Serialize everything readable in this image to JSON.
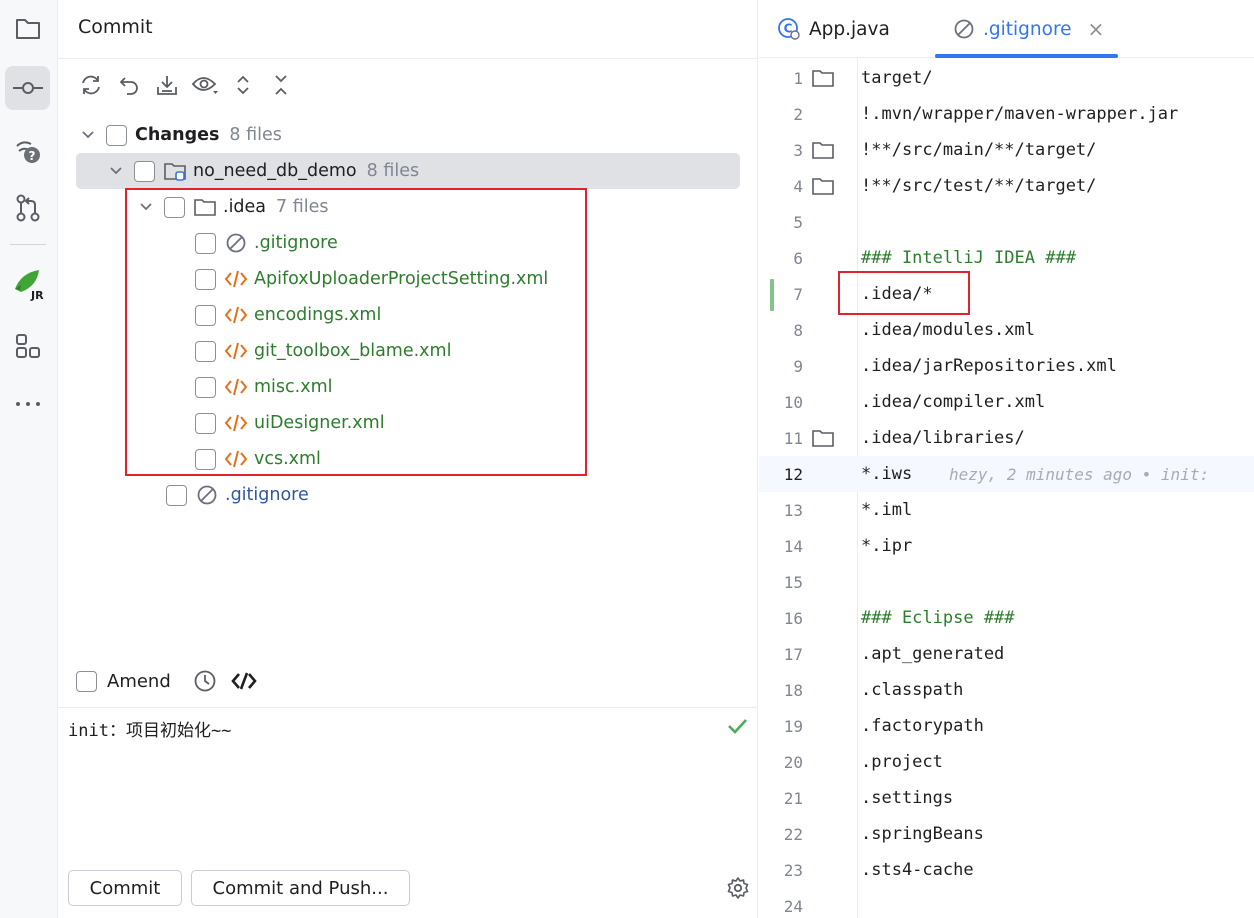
{
  "activity_bar": {
    "items": [
      {
        "name": "project-icon"
      },
      {
        "name": "commit-icon",
        "active": true
      },
      {
        "name": "vcs-hint-icon"
      },
      {
        "name": "pull-requests-icon"
      },
      {
        "name": "jrebel-icon",
        "label": "JR"
      },
      {
        "name": "structure-icon"
      },
      {
        "name": "more-icon"
      }
    ]
  },
  "commit_panel": {
    "title": "Commit",
    "toolbar": [
      "refresh-icon",
      "rollback-icon",
      "shelve-icon",
      "preview-icon",
      "expand-all-icon",
      "collapse-all-icon"
    ],
    "tree": {
      "changes": {
        "label": "Changes",
        "count": "8 files"
      },
      "module": {
        "label": "no_need_db_demo",
        "count": "8 files"
      },
      "idea": {
        "label": ".idea",
        "count": "7 files"
      },
      "idea_files": [
        {
          "label": ".gitignore",
          "icon": "ignore-icon"
        },
        {
          "label": "ApifoxUploaderProjectSetting.xml",
          "icon": "xml-icon"
        },
        {
          "label": "encodings.xml",
          "icon": "xml-icon"
        },
        {
          "label": "git_toolbox_blame.xml",
          "icon": "xml-icon"
        },
        {
          "label": "misc.xml",
          "icon": "xml-icon"
        },
        {
          "label": "uiDesigner.xml",
          "icon": "xml-icon"
        },
        {
          "label": "vcs.xml",
          "icon": "xml-icon"
        }
      ],
      "root_file": {
        "label": ".gitignore",
        "icon": "ignore-icon"
      }
    },
    "amend_label": "Amend",
    "message": "init：项目初始化~~",
    "commit_button": "Commit",
    "commit_push_button": "Commit and Push..."
  },
  "editor": {
    "tabs": [
      {
        "label": "App.java",
        "icon": "java-class-icon"
      },
      {
        "label": ".gitignore",
        "icon": "ignore-icon",
        "active": true,
        "close": "×"
      }
    ],
    "lines": [
      {
        "n": "1",
        "text": "target/",
        "folder": true
      },
      {
        "n": "2",
        "text": "!.mvn/wrapper/maven-wrapper.jar"
      },
      {
        "n": "3",
        "text": "!**/src/main/**/target/",
        "folder": true
      },
      {
        "n": "4",
        "text": "!**/src/test/**/target/",
        "folder": true
      },
      {
        "n": "5",
        "text": ""
      },
      {
        "n": "6",
        "text": "### IntelliJ IDEA ###",
        "comment": true
      },
      {
        "n": "7",
        "text": ".idea/*"
      },
      {
        "n": "8",
        "text": ".idea/modules.xml"
      },
      {
        "n": "9",
        "text": ".idea/jarRepositories.xml"
      },
      {
        "n": "10",
        "text": ".idea/compiler.xml"
      },
      {
        "n": "11",
        "text": ".idea/libraries/",
        "folder": true
      },
      {
        "n": "12",
        "text": "*.iws",
        "current": true,
        "blame": "hezy, 2 minutes ago • init:"
      },
      {
        "n": "13",
        "text": "*.iml"
      },
      {
        "n": "14",
        "text": "*.ipr"
      },
      {
        "n": "15",
        "text": ""
      },
      {
        "n": "16",
        "text": "### Eclipse ###",
        "comment": true
      },
      {
        "n": "17",
        "text": ".apt_generated"
      },
      {
        "n": "18",
        "text": ".classpath"
      },
      {
        "n": "19",
        "text": ".factorypath"
      },
      {
        "n": "20",
        "text": ".project"
      },
      {
        "n": "21",
        "text": ".settings"
      },
      {
        "n": "22",
        "text": ".springBeans"
      },
      {
        "n": "23",
        "text": ".sts4-cache"
      },
      {
        "n": "24",
        "text": ""
      }
    ]
  },
  "colors": {
    "accent": "#3574f0",
    "added_file": "#2d7d2d",
    "modified_file": "#2e56a3",
    "xml_icon": "#e5701b",
    "highlight_box": "#e0242d"
  }
}
